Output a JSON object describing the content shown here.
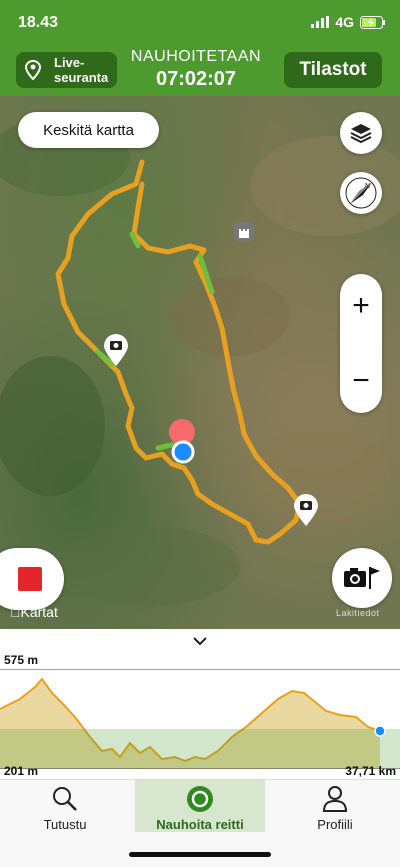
{
  "status_bar": {
    "time": "18.43",
    "network": "4G"
  },
  "header": {
    "live_label_1": "Live-",
    "live_label_2": "seuranta",
    "recording_title": "NAUHOITETAAN",
    "recording_time": "07:02:07",
    "stats_label": "Tilastot"
  },
  "map": {
    "center_button_label": "Keskitä kartta",
    "attribution": "Kartat",
    "legal_label": "Lakitiedot",
    "route_color": "#e8a020",
    "climb_color": "#6fbf3a",
    "start_color": "#f56b6b",
    "position_color": "#1a8cff"
  },
  "elevation": {
    "max_label": "575 m",
    "min_label": "201 m",
    "distance_label": "37,71 km"
  },
  "tabs": [
    {
      "label": "Tutustu",
      "icon": "search-icon"
    },
    {
      "label": "Nauhoita reitti",
      "icon": "record-icon",
      "active": true
    },
    {
      "label": "Profiili",
      "icon": "person-icon"
    }
  ]
}
